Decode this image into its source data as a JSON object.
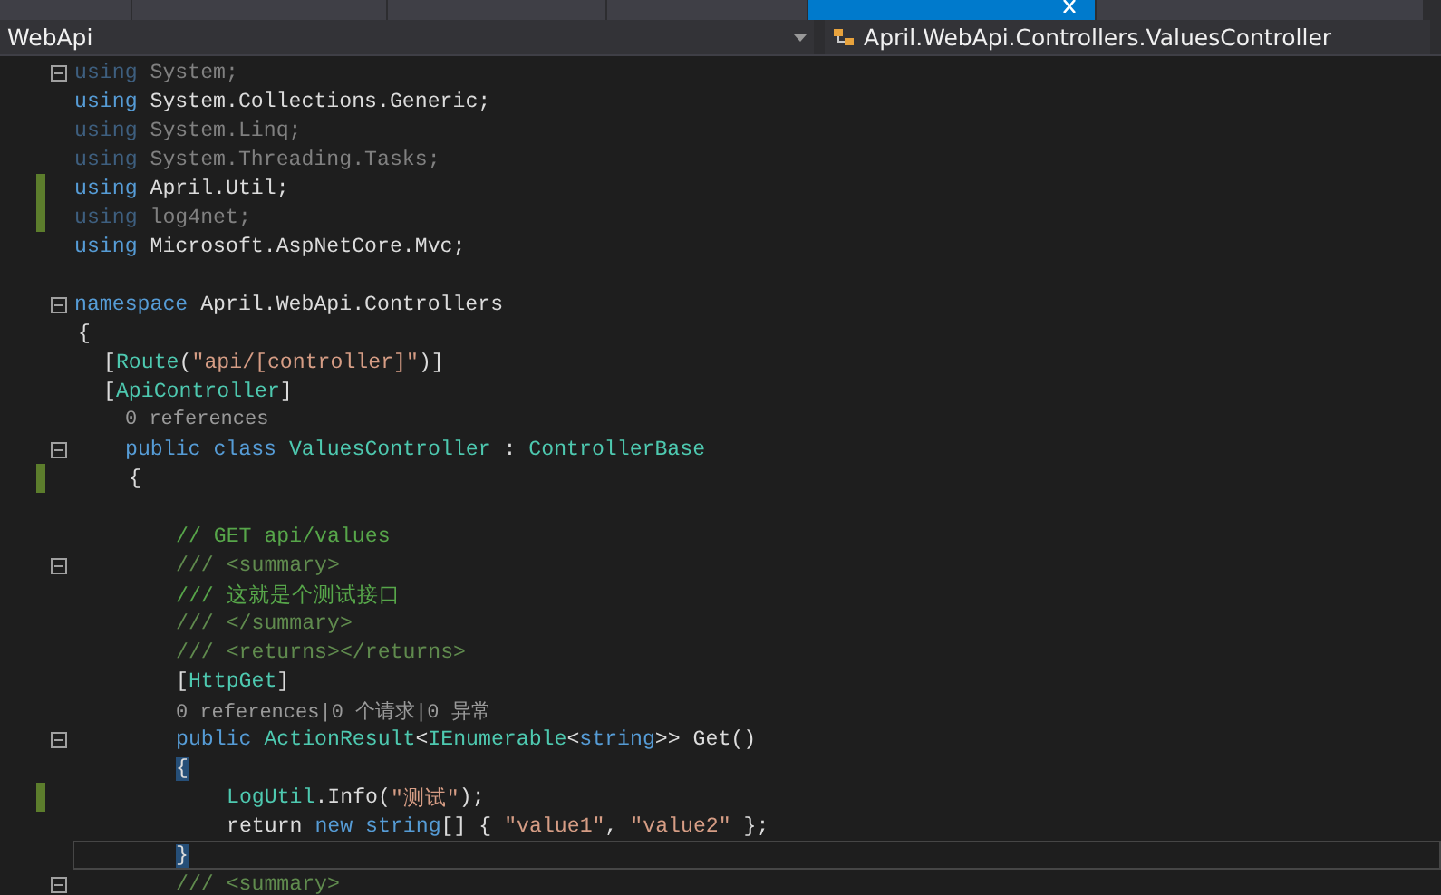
{
  "tabs": [
    {
      "selected": false
    },
    {
      "selected": false
    },
    {
      "selected": false
    },
    {
      "selected": false
    },
    {
      "selected": true
    },
    {
      "selected": false
    }
  ],
  "navigation": {
    "project": "WebApi",
    "member": "April.WebApi.Controllers.ValuesController"
  },
  "lines": [
    {
      "changed": false,
      "collapsible": true,
      "current": false,
      "tokens": [
        {
          "kind": "dim_keyword",
          "text": "using"
        },
        {
          "kind": "dim",
          "text": " System;"
        }
      ]
    },
    {
      "changed": false,
      "collapsible": false,
      "current": false,
      "tokens": [
        {
          "kind": "keyword",
          "text": "using"
        },
        {
          "kind": "plain",
          "text": " System.Collections.Generic;"
        }
      ]
    },
    {
      "changed": false,
      "collapsible": false,
      "current": false,
      "tokens": [
        {
          "kind": "dim_keyword",
          "text": "using"
        },
        {
          "kind": "dim",
          "text": " System.Linq;"
        }
      ]
    },
    {
      "changed": false,
      "collapsible": false,
      "current": false,
      "tokens": [
        {
          "kind": "dim_keyword",
          "text": "using"
        },
        {
          "kind": "dim",
          "text": " System.Threading.Tasks;"
        }
      ]
    },
    {
      "changed": true,
      "collapsible": false,
      "current": false,
      "tokens": [
        {
          "kind": "keyword",
          "text": "using"
        },
        {
          "kind": "plain",
          "text": " April.Util;"
        }
      ]
    },
    {
      "changed": true,
      "collapsible": false,
      "current": false,
      "tokens": [
        {
          "kind": "dim_keyword",
          "text": "using"
        },
        {
          "kind": "dim",
          "text": " log4net;"
        }
      ]
    },
    {
      "changed": false,
      "collapsible": false,
      "current": false,
      "tokens": [
        {
          "kind": "keyword",
          "text": "using"
        },
        {
          "kind": "plain",
          "text": " Microsoft.AspNetCore.Mvc;"
        }
      ]
    },
    {
      "changed": false,
      "collapsible": false,
      "current": false
    },
    {
      "changed": false,
      "collapsible": true,
      "current": false,
      "tokens": [
        {
          "kind": "keyword",
          "text": "namespace"
        },
        {
          "kind": "plain",
          "text": " April.WebApi.Controllers"
        }
      ]
    },
    {
      "changed": false,
      "collapsible": false,
      "current": false,
      "tokens": [
        {
          "kind": "plain",
          "text": "{"
        }
      ]
    },
    {
      "changed": false,
      "collapsible": false,
      "current": false,
      "tokens": [
        {
          "kind": "plain",
          "text": "["
        },
        {
          "kind": "type",
          "text": "Route"
        },
        {
          "kind": "plain",
          "text": "("
        },
        {
          "kind": "string",
          "text": "\"api/[controller]\""
        },
        {
          "kind": "plain",
          "text": ")]"
        }
      ]
    },
    {
      "changed": false,
      "collapsible": false,
      "current": false,
      "tokens": [
        {
          "kind": "plain",
          "text": "["
        },
        {
          "kind": "type",
          "text": "ApiController"
        },
        {
          "kind": "plain",
          "text": "]"
        }
      ]
    },
    {
      "changed": false,
      "collapsible": false,
      "current": false,
      "tokens": [
        {
          "kind": "lens",
          "text": "0 references"
        }
      ]
    },
    {
      "changed": false,
      "collapsible": true,
      "current": false,
      "tokens": [
        {
          "kind": "keyword",
          "text": "public class "
        },
        {
          "kind": "type",
          "text": "ValuesController"
        },
        {
          "kind": "plain",
          "text": " : "
        },
        {
          "kind": "type",
          "text": "ControllerBase"
        }
      ]
    },
    {
      "changed": true,
      "collapsible": false,
      "current": false,
      "tokens": [
        {
          "kind": "plain",
          "text": "{"
        }
      ]
    },
    {
      "changed": false,
      "collapsible": false,
      "current": false
    },
    {
      "changed": false,
      "collapsible": false,
      "current": false,
      "tokens": [
        {
          "kind": "comment",
          "text": "// GET api/values"
        }
      ]
    },
    {
      "changed": false,
      "collapsible": true,
      "current": false,
      "tokens": [
        {
          "kind": "doc",
          "text": "/// <summary>"
        }
      ]
    },
    {
      "changed": false,
      "collapsible": false,
      "current": false,
      "tokens": [
        {
          "kind": "comment",
          "text": "/// 这就是个测试接口"
        }
      ]
    },
    {
      "changed": false,
      "collapsible": false,
      "current": false,
      "tokens": [
        {
          "kind": "doc",
          "text": "/// </summary>"
        }
      ]
    },
    {
      "changed": false,
      "collapsible": false,
      "current": false,
      "tokens": [
        {
          "kind": "doc",
          "text": "/// <returns></returns>"
        }
      ]
    },
    {
      "changed": false,
      "collapsible": false,
      "current": false,
      "tokens": [
        {
          "kind": "plain",
          "text": "["
        },
        {
          "kind": "type",
          "text": "HttpGet"
        },
        {
          "kind": "plain",
          "text": "]"
        }
      ]
    },
    {
      "changed": false,
      "collapsible": false,
      "current": false,
      "tokens": [
        {
          "kind": "lens",
          "text": "0 references|0 个请求|0 异常"
        }
      ]
    },
    {
      "changed": false,
      "collapsible": true,
      "current": false,
      "tokens": [
        {
          "kind": "keyword",
          "text": "public "
        },
        {
          "kind": "type",
          "text": "ActionResult"
        },
        {
          "kind": "plain",
          "text": "<"
        },
        {
          "kind": "type",
          "text": "IEnumerable"
        },
        {
          "kind": "plain",
          "text": "<"
        },
        {
          "kind": "keyword",
          "text": "string"
        },
        {
          "kind": "plain",
          "text": ">> Get()"
        }
      ]
    },
    {
      "changed": false,
      "collapsible": false,
      "current": false,
      "tokens": [
        {
          "kind": "brace_match",
          "text": "{"
        }
      ]
    },
    {
      "changed": true,
      "collapsible": false,
      "current": false,
      "tokens": [
        {
          "kind": "type",
          "text": "LogUtil"
        },
        {
          "kind": "plain",
          "text": ".Info("
        },
        {
          "kind": "string",
          "text": "\"测试\""
        },
        {
          "kind": "plain",
          "text": ");"
        }
      ]
    },
    {
      "changed": false,
      "collapsible": false,
      "current": false,
      "tokens": [
        {
          "kind": "plain",
          "text": "return "
        },
        {
          "kind": "keyword",
          "text": "new string"
        },
        {
          "kind": "plain",
          "text": "[] { "
        },
        {
          "kind": "string",
          "text": "\"value1\""
        },
        {
          "kind": "plain",
          "text": ", "
        },
        {
          "kind": "string",
          "text": "\"value2\""
        },
        {
          "kind": "plain",
          "text": " };"
        }
      ]
    },
    {
      "changed": false,
      "collapsible": false,
      "current": true,
      "tokens": [
        {
          "kind": "brace_match",
          "text": "}"
        }
      ]
    },
    {
      "changed": false,
      "collapsible": true,
      "current": false,
      "tokens": [
        {
          "kind": "doc",
          "text": "/// <summary>"
        }
      ]
    }
  ]
}
